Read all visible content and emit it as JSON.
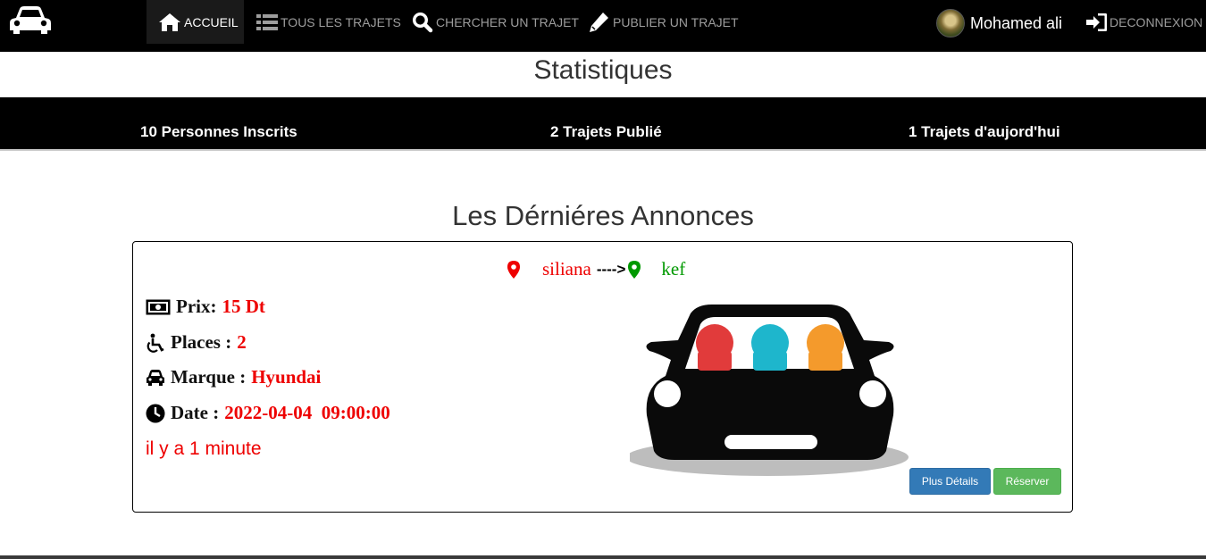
{
  "navbar": {
    "brand_icon": "car-icon",
    "items": [
      {
        "label": "ACCUEIL",
        "icon": "home-icon",
        "active": true
      },
      {
        "label": "TOUS LES TRAJETS",
        "icon": "list-icon"
      },
      {
        "label": "CHERCHER UN TRAJET",
        "icon": "search-icon"
      },
      {
        "label": "PUBLIER UN TRAJET",
        "icon": "pencil-icon"
      }
    ],
    "user": {
      "name": "Mohamed ali",
      "avatar": "avatar"
    },
    "logout": {
      "label": "DECONNEXION",
      "icon": "sign-in-icon"
    }
  },
  "stats": {
    "title": "Statistiques",
    "items": [
      "10 Personnes Inscrits",
      "2 Trajets Publié",
      "1 Trajets d'aujord'hui"
    ]
  },
  "announcements": {
    "title": "Les Dérniéres Annonces",
    "card": {
      "from": "siliana",
      "arrow": "---->",
      "to": "kef",
      "price_label": "Prix:",
      "price_value": "15 Dt",
      "places_label": "Places :",
      "places_value": "2",
      "brand_label": "Marque :",
      "brand_value": "Hyundai",
      "date_label": "Date :",
      "date_value": "2022-04-04  09:00:00",
      "ago": "il y a 1 minute",
      "details_button": "Plus Détails",
      "reserve_button": "Réserver"
    }
  },
  "colors": {
    "navbar": "#000000",
    "accent_red": "#ee0000",
    "destination_green": "#009900",
    "primary_btn": "#337ab7",
    "success_btn": "#5cb85c"
  }
}
